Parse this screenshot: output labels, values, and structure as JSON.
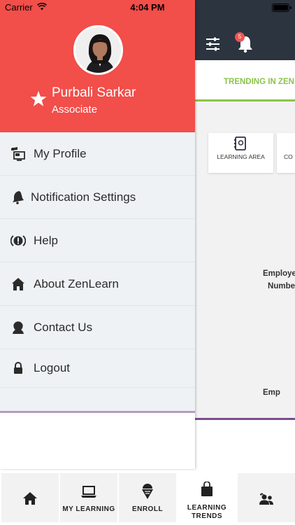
{
  "status_bar": {
    "carrier": "Carrier",
    "time": "4:04 PM"
  },
  "header": {
    "notification_count": "5",
    "trending_tab": "TRENDING IN ZEN"
  },
  "cards": [
    {
      "label": "LEARNING AREA",
      "icon": "address-book-icon"
    },
    {
      "label": "CO"
    }
  ],
  "content": {
    "employee_label_1": "Employe",
    "employee_label_1b": "Numbe",
    "employee_label_2": "Emp"
  },
  "drawer": {
    "user_name": "Purbali Sarkar",
    "user_role": "Associate",
    "items": [
      {
        "label": "My Profile",
        "icon": "profile-monitor-icon"
      },
      {
        "label": "Notification Settings",
        "icon": "bell-icon"
      },
      {
        "label": "Help",
        "icon": "help-icon"
      },
      {
        "label": "About ZenLearn",
        "icon": "home-icon"
      },
      {
        "label": "Contact Us",
        "icon": "contact-icon"
      },
      {
        "label": "Logout",
        "icon": "lock-icon"
      }
    ]
  },
  "tabs": [
    {
      "label": "",
      "icon": "home-icon"
    },
    {
      "label": "MY LEARNING",
      "icon": "laptop-icon"
    },
    {
      "label": "ENROLL",
      "icon": "ice-cream-icon"
    },
    {
      "label": "LEARNING TRENDS",
      "icon": "shopping-bag-icon"
    },
    {
      "label": "",
      "icon": "users-icon"
    }
  ],
  "colors": {
    "drawer_header": "#f24e4a",
    "accent_green": "#8bc34a",
    "accent_purple": "#7b4c8e",
    "app_header": "#2c3440"
  }
}
